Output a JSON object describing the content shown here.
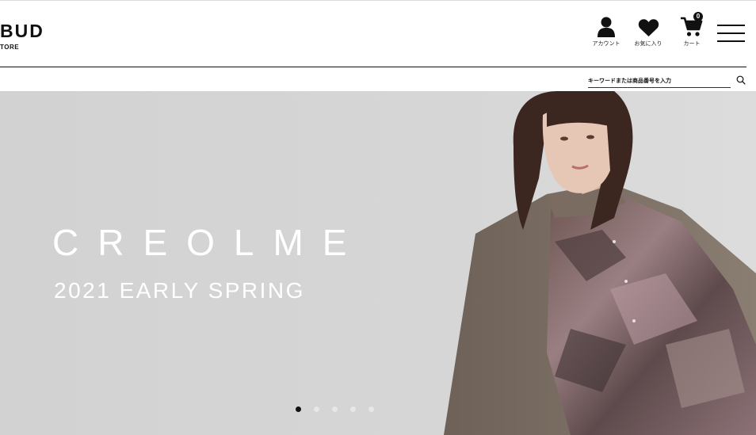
{
  "header": {
    "logo": "BUD",
    "logo_sub": "TORE",
    "account_label": "アカウント",
    "favorites_label": "お気に入り",
    "cart_label": "カート",
    "cart_count": "0"
  },
  "search": {
    "placeholder": "キーワードまたは商品番号を入力"
  },
  "hero": {
    "title": "CREOLME",
    "subtitle": "2021 EARLY SPRING",
    "slide_count": 5,
    "active_slide": 1
  },
  "colors": {
    "hero_background": "#d4d4d4",
    "text_primary": "#111111",
    "hero_text": "#ffffff"
  }
}
